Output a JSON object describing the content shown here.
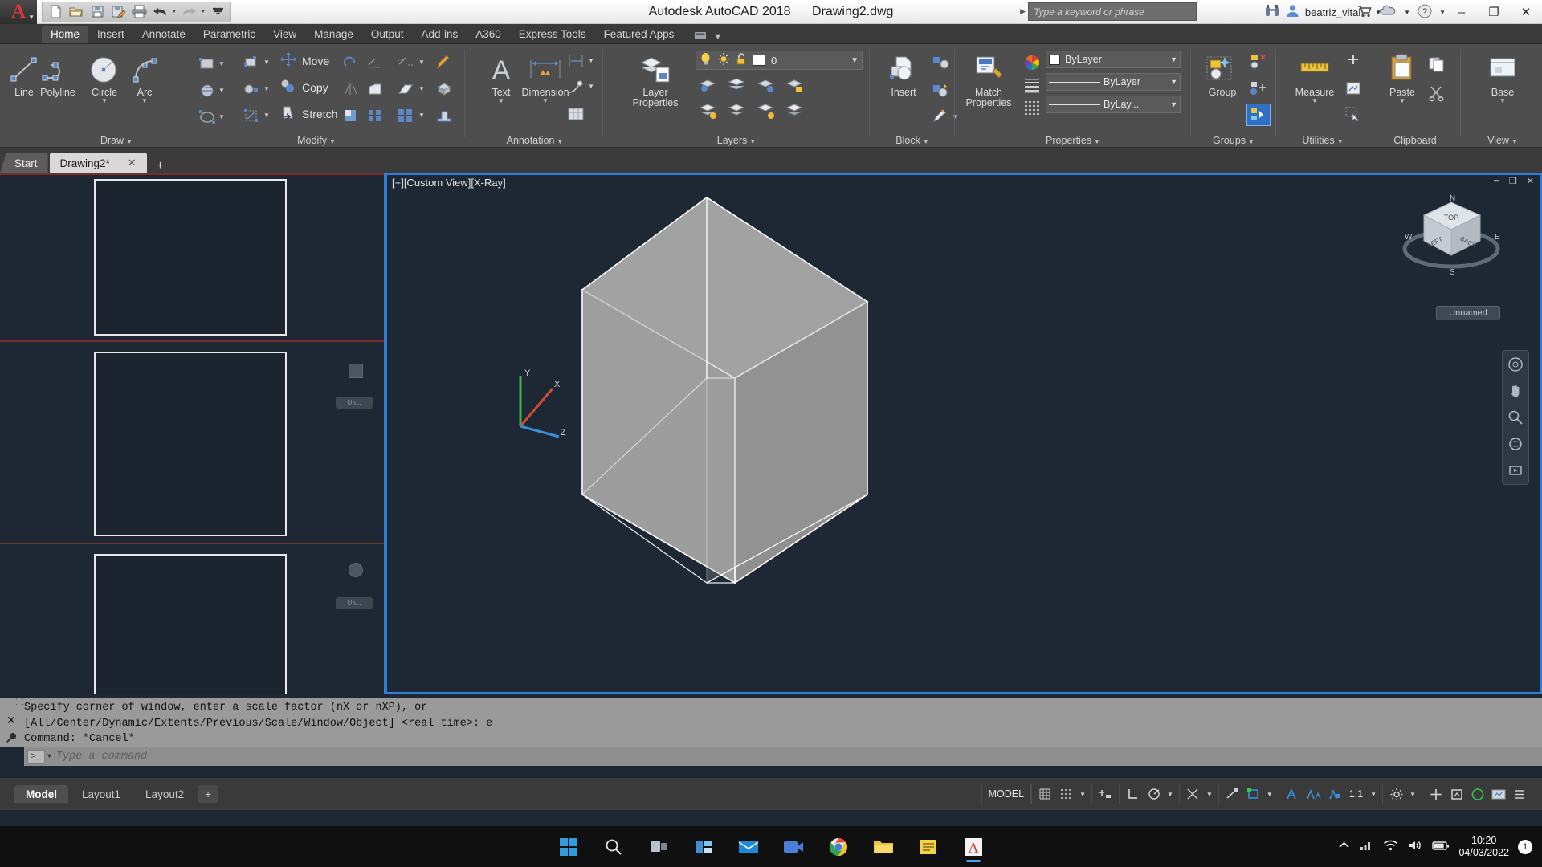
{
  "titlebar": {
    "app_title": "Autodesk AutoCAD 2018",
    "file_name": "Drawing2.dwg",
    "app_menu_icon": "autocad-a-icon",
    "quick_access": [
      {
        "name": "new-icon",
        "label": "New"
      },
      {
        "name": "open-icon",
        "label": "Open"
      },
      {
        "name": "save-icon",
        "label": "Save"
      },
      {
        "name": "saveas-icon",
        "label": "Save As"
      },
      {
        "name": "plot-icon",
        "label": "Plot"
      },
      {
        "name": "undo-icon",
        "label": "Undo"
      },
      {
        "name": "redo-icon",
        "label": "Redo"
      },
      {
        "name": "qat-more-icon",
        "label": "Customize Quick Access Toolbar"
      }
    ],
    "search_placeholder": "Type a keyword or phrase",
    "search_value": "",
    "infocenter_icon": "binoculars-icon",
    "account_name": "beatriz_vital...",
    "account_icon": "user-icon",
    "autodesk_app_store_icon": "cart-icon",
    "stay_connected_icon": "cloud-icon",
    "help_icon": "help-icon",
    "window_minimize": "–",
    "window_restore": "❐",
    "window_close": "✕"
  },
  "ribbon_tabs": [
    {
      "label": "Home",
      "active": true
    },
    {
      "label": "Insert",
      "active": false
    },
    {
      "label": "Annotate",
      "active": false
    },
    {
      "label": "Parametric",
      "active": false
    },
    {
      "label": "View",
      "active": false
    },
    {
      "label": "Manage",
      "active": false
    },
    {
      "label": "Output",
      "active": false
    },
    {
      "label": "Add-ins",
      "active": false
    },
    {
      "label": "A360",
      "active": false
    },
    {
      "label": "Express Tools",
      "active": false
    },
    {
      "label": "Featured Apps",
      "active": false
    }
  ],
  "ribbon_panels": {
    "draw": {
      "title": "Draw",
      "buttons": [
        {
          "label": "Line",
          "icon": "line-icon",
          "dropdown": false
        },
        {
          "label": "Polyline",
          "icon": "polyline-icon",
          "dropdown": false
        },
        {
          "label": "Circle",
          "icon": "circle-icon",
          "dropdown": true
        },
        {
          "label": "Arc",
          "icon": "arc-icon",
          "dropdown": true
        }
      ],
      "small_tools": [
        "rectangle-icon",
        "hatch-icon",
        "ellipse-icon"
      ]
    },
    "modify": {
      "title": "Modify",
      "buttons": [
        {
          "label": "Move",
          "icon": "move-icon"
        },
        {
          "label": "Copy",
          "icon": "copy-icon"
        },
        {
          "label": "Stretch",
          "icon": "stretch-icon"
        }
      ],
      "small_tools": [
        "rotate-icon",
        "mirror-icon",
        "scale-icon",
        "trim-icon",
        "fillet-icon",
        "array-icon",
        "erase-icon",
        "explode-icon",
        "offset-icon"
      ]
    },
    "annotation": {
      "title": "Annotation",
      "buttons": [
        {
          "label": "Text",
          "icon": "text-a-icon",
          "dropdown": true
        },
        {
          "label": "Dimension",
          "icon": "dimension-icon",
          "dropdown": true
        }
      ],
      "small_tools": [
        "linear-dim-icon",
        "leader-icon",
        "table-icon"
      ]
    },
    "layers": {
      "title": "Layers",
      "main_button": {
        "label": "Layer Properties",
        "icon": "layer-properties-icon"
      },
      "layer_state": {
        "on_icon": "lightbulb-icon",
        "freeze_icon": "sun-icon",
        "lock_icon": "unlock-icon",
        "color_swatch": "#ffffff",
        "current_layer": "0"
      },
      "small_tools": [
        "layer-isolate-icon",
        "layer-unisolate-icon",
        "layer-freeze-icon",
        "layer-off-icon",
        "layer-on-icon",
        "layer-lock-icon",
        "layer-unlock-icon",
        "layer-match-icon",
        "layer-previous-icon"
      ]
    },
    "block": {
      "title": "Block",
      "main_button": {
        "label": "Insert",
        "icon": "insert-block-icon"
      },
      "small_tools": [
        "create-block-icon",
        "edit-block-icon",
        "edit-attribute-icon"
      ]
    },
    "properties": {
      "title": "Properties",
      "match_button": {
        "label": "Match Properties",
        "icon": "match-properties-icon"
      },
      "color": {
        "value": "ByLayer",
        "icon": "color-wheel-icon",
        "swatch": "#ffffff"
      },
      "linewidth": {
        "value": "ByLayer",
        "icon": "lineweight-icon"
      },
      "linetype": {
        "value": "ByLay...",
        "icon": "linetype-icon"
      }
    },
    "groups": {
      "title": "Groups",
      "main_button": {
        "label": "Group",
        "icon": "group-icon"
      },
      "small_tools": [
        "ungroup-icon",
        "add-to-group-icon",
        "group-selection-on-off-icon"
      ]
    },
    "utilities": {
      "title": "Utilities",
      "main_button": {
        "label": "Measure",
        "icon": "measure-icon",
        "dropdown": true
      },
      "small_tools": [
        "quick-calc-icon",
        "id-point-icon",
        "quick-select-icon"
      ]
    },
    "clipboard": {
      "title": "Clipboard",
      "main_button": {
        "label": "Paste",
        "icon": "paste-icon",
        "dropdown": true
      },
      "small_tools": [
        "copy-clip-icon",
        "cut-clip-icon"
      ]
    },
    "view": {
      "title": "View",
      "main_button": {
        "label": "Base",
        "icon": "base-view-icon",
        "dropdown": true
      }
    }
  },
  "file_tabs": [
    {
      "label": "Start",
      "active": false,
      "closable": false
    },
    {
      "label": "Drawing2*",
      "active": true,
      "closable": true
    }
  ],
  "file_tab_new": "+",
  "viewport": {
    "label": "[+][Custom View][X-Ray]",
    "viewcube_faces": {
      "top": "TOP",
      "front": "LEFT",
      "right": "BACK"
    },
    "compass": {
      "n": "N",
      "e": "E",
      "s": "S",
      "w": "W"
    },
    "view_name": "Unnamed",
    "ucs_axes": {
      "x": "X",
      "y": "Y",
      "z": "Z"
    },
    "minimize_icon": "minimize-icon",
    "restore_icon": "restore-icon",
    "close_icon": "close-icon",
    "nav_tools": [
      "full-navigation-wheel-icon",
      "pan-icon",
      "zoom-extents-icon",
      "orbit-icon",
      "showmotion-icon"
    ]
  },
  "command_line": {
    "history": [
      "Specify corner of window, enter a scale factor (nX or nXP), or",
      "[All/Center/Dynamic/Extents/Previous/Scale/Window/Object] <real time>: e",
      "Command: *Cancel*"
    ],
    "placeholder": "Type a command",
    "value": "",
    "prompt_icon": "command-prompt-icon",
    "close_icon": "✕"
  },
  "status_bar": {
    "layout_tabs": [
      {
        "label": "Model",
        "active": true
      },
      {
        "label": "Layout1",
        "active": false
      },
      {
        "label": "Layout2",
        "active": false
      }
    ],
    "new_layout": "+",
    "space_toggle": "MODEL",
    "scale": "1:1",
    "tools": [
      {
        "name": "grid-display-icon",
        "dropdown": false
      },
      {
        "name": "snap-mode-icon",
        "dropdown": true
      },
      {
        "name": "infer-constraints-icon",
        "dropdown": false
      },
      {
        "name": "ortho-mode-icon",
        "dropdown": false
      },
      {
        "name": "polar-tracking-icon",
        "dropdown": true
      },
      {
        "name": "object-snap-tracking-icon",
        "dropdown": true
      },
      {
        "name": "object-snap-icon",
        "dropdown": false
      },
      {
        "name": "lineweight-icon",
        "dropdown": false
      },
      {
        "name": "workspace-switching-icon",
        "dropdown": true
      },
      {
        "name": "annotation-visibility-icon",
        "dropdown": false
      },
      {
        "name": "autoscale-icon",
        "dropdown": false
      },
      {
        "name": "annotation-scale-icon",
        "dropdown": true
      },
      {
        "name": "settings-gear-icon",
        "dropdown": true
      },
      {
        "name": "customization-icon",
        "dropdown": false
      },
      {
        "name": "isolate-objects-icon",
        "dropdown": false
      },
      {
        "name": "graphics-performance-icon",
        "dropdown": false
      },
      {
        "name": "clean-screen-icon",
        "dropdown": false
      },
      {
        "name": "hardware-acceleration-icon",
        "dropdown": false
      }
    ]
  },
  "taskbar": {
    "items": [
      {
        "name": "start-button-icon",
        "label": "Start"
      },
      {
        "name": "search-icon",
        "label": "Search"
      },
      {
        "name": "task-view-icon",
        "label": "Task View"
      },
      {
        "name": "widgets-icon",
        "label": "Widgets"
      },
      {
        "name": "mail-icon",
        "label": "Mail"
      },
      {
        "name": "teams-icon",
        "label": "Teams"
      },
      {
        "name": "chrome-icon",
        "label": "Google Chrome"
      },
      {
        "name": "file-explorer-icon",
        "label": "File Explorer"
      },
      {
        "name": "sticky-notes-icon",
        "label": "Notes"
      },
      {
        "name": "autocad-taskbar-icon",
        "label": "AutoCAD"
      }
    ],
    "tray": [
      {
        "name": "show-hidden-icons-icon"
      },
      {
        "name": "network-activity-icon"
      },
      {
        "name": "wifi-icon"
      },
      {
        "name": "volume-icon"
      },
      {
        "name": "battery-icon"
      }
    ],
    "clock_time": "10:20",
    "clock_date": "04/03/2022",
    "notification_count": "1"
  },
  "colors": {
    "canvas_bg": "#1e2834",
    "ribbon_bg": "#4e4e4e",
    "accent_blue": "#2f7fd8",
    "cube_fill_light": "#aaaaaa",
    "cube_fill_mid": "#9a9a9a",
    "cube_fill_dark": "#8d8d8d",
    "cube_edge": "#ffffff"
  }
}
